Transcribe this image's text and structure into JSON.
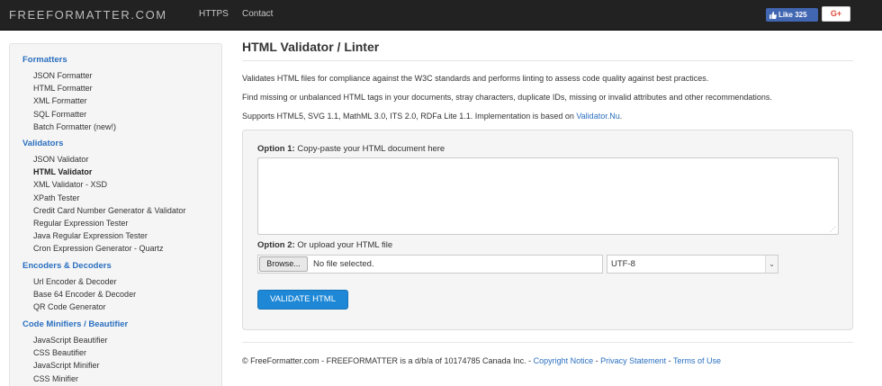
{
  "header": {
    "brand": "FREEFORMATTER.COM",
    "nav": [
      "HTTPS",
      "Contact"
    ],
    "fb_like": "Like 325",
    "gplus": "G+"
  },
  "sidebar": {
    "sections": [
      {
        "title": "Formatters",
        "items": [
          "JSON Formatter",
          "HTML Formatter",
          "XML Formatter",
          "SQL Formatter",
          "Batch Formatter (new!)"
        ]
      },
      {
        "title": "Validators",
        "items": [
          "JSON Validator",
          "HTML Validator",
          "XML Validator - XSD",
          "XPath Tester",
          "Credit Card Number Generator & Validator",
          "Regular Expression Tester",
          "Java Regular Expression Tester",
          "Cron Expression Generator - Quartz"
        ]
      },
      {
        "title": "Encoders & Decoders",
        "items": [
          "Url Encoder & Decoder",
          "Base 64 Encoder & Decoder",
          "QR Code Generator"
        ]
      },
      {
        "title": "Code Minifiers / Beautifier",
        "items": [
          "JavaScript Beautifier",
          "CSS Beautifier",
          "JavaScript Minifier",
          "CSS Minifier"
        ]
      }
    ],
    "active_item": "HTML Validator"
  },
  "main": {
    "title": "HTML Validator / Linter",
    "paragraphs": [
      "Validates HTML files for compliance against the W3C standards and performs linting to assess code quality against best practices.",
      "Find missing or unbalanced HTML tags in your documents, stray characters, duplicate IDs, missing or invalid attributes and other recommendations."
    ],
    "supports_text": "Supports HTML5, SVG 1.1, MathML 3.0, ITS 2.0, RDFa Lite 1.1. Implementation is based on ",
    "supports_link": "Validator.Nu",
    "supports_end": ".",
    "option1_prefix": "Option 1:",
    "option1_text": " Copy-paste your HTML document here",
    "textarea_value": "",
    "option2_prefix": "Option 2:",
    "option2_text": " Or upload your HTML file",
    "browse_label": "Browse...",
    "file_status": "No file selected.",
    "charset_value": "UTF-8",
    "validate_label": "VALIDATE HTML"
  },
  "footer": {
    "text": "© FreeFormatter.com - FREEFORMATTER is a d/b/a of 10174785 Canada Inc. - ",
    "links": [
      "Copyright Notice",
      "Privacy Statement",
      "Terms of Use"
    ],
    "separator": " - "
  },
  "colors": {
    "navbar_bg": "#222222",
    "link_blue": "#2a6fbf",
    "button_blue": "#1e88d6",
    "fb_blue": "#4267b2",
    "gplus_red": "#dd4b39"
  }
}
